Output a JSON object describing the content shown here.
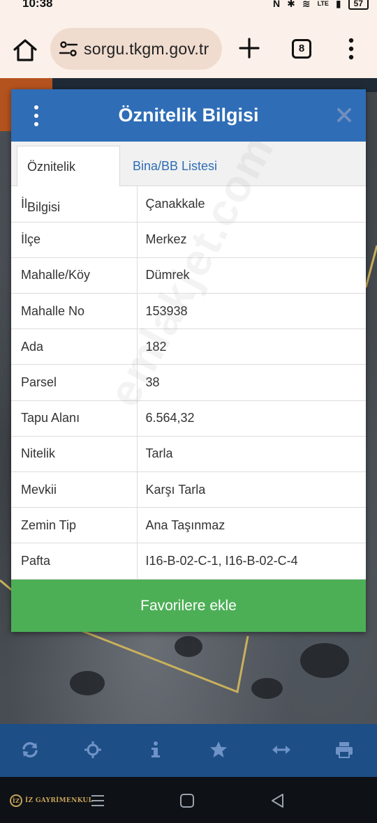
{
  "status_bar": {
    "time": "10:38",
    "network": "LTE",
    "battery": "57"
  },
  "browser": {
    "url": "sorgu.tkgm.gov.tr",
    "tab_count": "8"
  },
  "modal": {
    "title": "Öznitelik Bilgisi",
    "tabs": [
      {
        "label": "Öznitelik Bilgisi",
        "active": true
      },
      {
        "label": "Bina/BB Listesi",
        "active": false
      }
    ],
    "rows": [
      {
        "key": "İl",
        "value": "Çanakkale"
      },
      {
        "key": "İlçe",
        "value": "Merkez"
      },
      {
        "key": "Mahalle/Köy",
        "value": "Dümrek"
      },
      {
        "key": "Mahalle No",
        "value": "153938"
      },
      {
        "key": "Ada",
        "value": "182"
      },
      {
        "key": "Parsel",
        "value": "38"
      },
      {
        "key": "Tapu Alanı",
        "value": "6.564,32"
      },
      {
        "key": "Nitelik",
        "value": "Tarla"
      },
      {
        "key": "Mevkii",
        "value": "Karşı Tarla"
      },
      {
        "key": "Zemin Tip",
        "value": "Ana Taşınmaz"
      },
      {
        "key": "Pafta",
        "value": "I16-B-02-C-1, I16-B-02-C-4"
      }
    ],
    "favorite_label": "Favorilere ekle"
  },
  "toolbar_icons": [
    "refresh-icon",
    "crosshair-icon",
    "info-icon",
    "star-icon",
    "measure-icon",
    "print-icon"
  ],
  "navbar": {
    "brand_mark": "İZ",
    "brand_name": "İZ GAYRİMENKUL"
  },
  "watermark": "emlakjet.com",
  "colors": {
    "header_blue": "#2f6db7",
    "favorite_green": "#4caf56",
    "toolbar_blue": "#1d4e86",
    "browser_bg": "#fbf1ea"
  }
}
